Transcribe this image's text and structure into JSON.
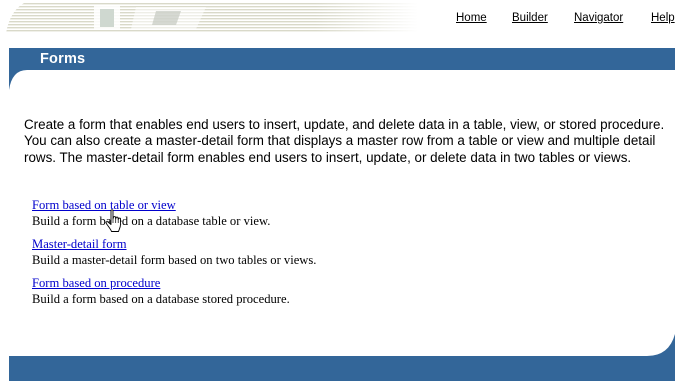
{
  "header": {
    "nav": {
      "home": "Home",
      "builder": "Builder",
      "navigator": "Navigator",
      "help": "Help"
    }
  },
  "page": {
    "title": "Forms",
    "intro": "Create a form that enables end users to insert, update, and delete data in a table, view, or stored procedure. You can also create a master-detail form that displays a master row from a table or view and multiple detail rows. The master-detail form enables end users to insert, update, or delete data in two tables or views."
  },
  "options": [
    {
      "label": "Form based on table or view",
      "description": "Build a form based on a database table or view."
    },
    {
      "label": "Master-detail form",
      "description": "Build a master-detail form based on two tables or views."
    },
    {
      "label": "Form based on procedure",
      "description": "Build a form based on a database stored procedure."
    }
  ],
  "colors": {
    "banner": "#336699",
    "link": "#0000cc",
    "logo_stripes": "#d8d8c8"
  },
  "icons": {
    "cursor": "hand-pointer-icon",
    "logo": "faded-logo-banner"
  }
}
